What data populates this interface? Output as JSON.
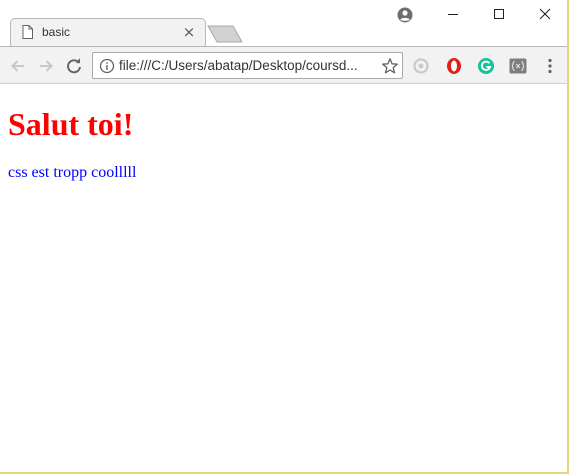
{
  "browser": {
    "tab": {
      "title": "basic",
      "close_glyph": "×",
      "icon": "document-icon"
    },
    "new_tab_icon": "new-tab-icon",
    "window_controls": [
      "minimize-icon",
      "maximize-icon",
      "close-icon"
    ],
    "profile_icon": "profile-icon"
  },
  "toolbar": {
    "nav_icons": [
      "back-arrow-icon",
      "forward-arrow-icon",
      "reload-icon"
    ],
    "address": {
      "info_icon": "info-icon",
      "url": "file:///C:/Users/abatap/Desktop/coursd...",
      "bookmark_icon": "star-icon"
    },
    "extensions": [
      "grey-extension-icon",
      "opera-red-extension-icon",
      "grammarly-extension-icon",
      "variable-extension-icon"
    ],
    "menu_icon": "kebab-menu-icon"
  },
  "page": {
    "heading": "Salut toi!",
    "paragraph": "css est tropp coolllll",
    "colors": {
      "heading": "#ff0000",
      "paragraph": "#0000ff"
    }
  }
}
